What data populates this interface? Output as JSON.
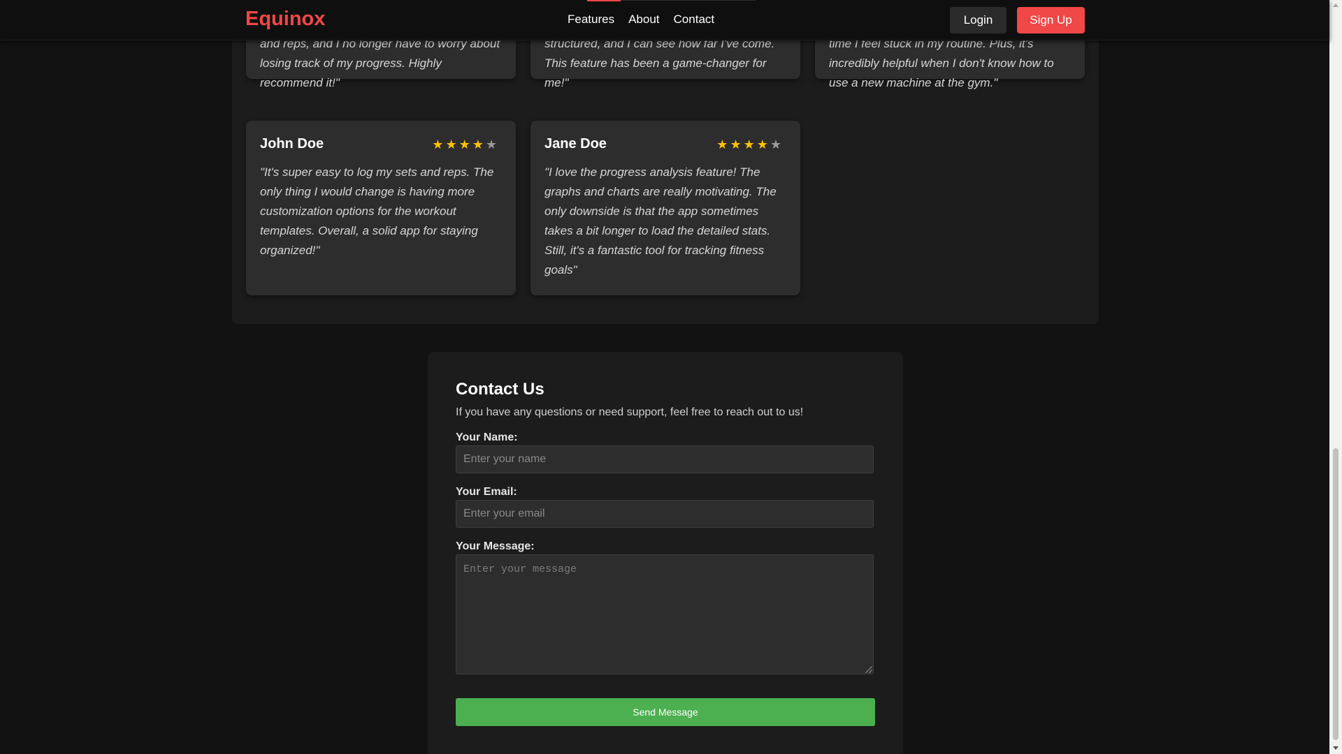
{
  "nav": {
    "brand": "Equinox",
    "links": [
      "Features",
      "About",
      "Contact"
    ],
    "login": "Login",
    "signup": "Sign Up"
  },
  "testimonials": {
    "top_row": [
      {
        "quote_tail": "and reps, and I no longer have to worry about losing track of my progress. Highly recommend it!\""
      },
      {
        "quote_tail": "structured, and I can see how far I've come. This feature has been a game-changer for me!\""
      },
      {
        "quote_tail": "time I feel stuck in my routine. Plus, it's incredibly helpful when I don't know how to use a new machine at the gym.\""
      }
    ],
    "bottom_row": [
      {
        "name": "John Doe",
        "rating": 4,
        "max_rating": 5,
        "quote": "\"It's super easy to log my sets and reps. The only thing I would change is having more customization options for the workout templates. Overall, a solid app for staying organized!\""
      },
      {
        "name": "Jane Doe",
        "rating": 4,
        "max_rating": 5,
        "quote": "\"I love the progress analysis feature! The graphs and charts are really motivating. The only downside is that the app sometimes takes a bit longer to load the detailed stats. Still, it's a fantastic tool for tracking fitness goals\""
      }
    ]
  },
  "contact": {
    "title": "Contact Us",
    "description": "If you have any questions or need support, feel free to reach out to us!",
    "name_label": "Your Name:",
    "name_placeholder": "Enter your name",
    "name_value": "",
    "email_label": "Your Email:",
    "email_placeholder": "Enter your email",
    "email_value": "",
    "message_label": "Your Message:",
    "message_placeholder": "Enter your message",
    "message_value": "",
    "send_label": "Send Message"
  },
  "colors": {
    "accent": "#f04747",
    "send_button": "#4caf50",
    "star": "#ffc107",
    "star_empty": "#9a9a9a"
  }
}
